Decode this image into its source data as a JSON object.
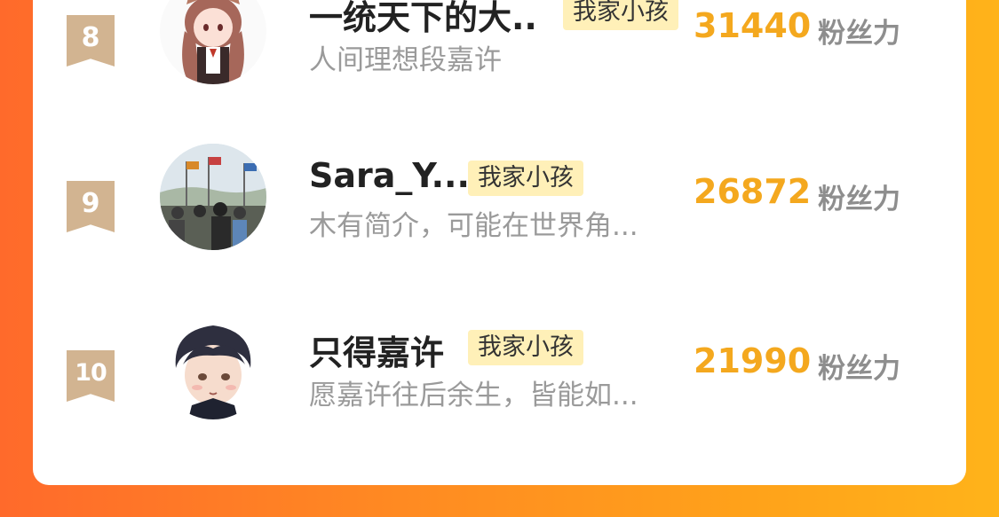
{
  "leaderboard": {
    "unit_label": "粉丝力",
    "rows": [
      {
        "rank": "8",
        "name": "一统天下的大..",
        "tag": "我家小孩",
        "description": "人间理想段嘉许",
        "score": "31440",
        "avatar_icon": "anime-girl-avatar"
      },
      {
        "rank": "9",
        "name": "Sara_Y...",
        "tag": "我家小孩",
        "description": "木有简介，可能在世界角...",
        "score": "26872",
        "avatar_icon": "photo-crowd-avatar"
      },
      {
        "rank": "10",
        "name": "只得嘉许",
        "tag": "我家小孩",
        "description": "愿嘉许往后余生，皆能如...",
        "score": "21990",
        "avatar_icon": "anime-boy-avatar"
      }
    ]
  },
  "colors": {
    "accent_score": "#f4a81e",
    "rank_badge": "#d2b491",
    "tag_background": "#fff0b8",
    "background_gradient_start": "#ff6a2b",
    "background_gradient_end": "#ffb31a"
  }
}
